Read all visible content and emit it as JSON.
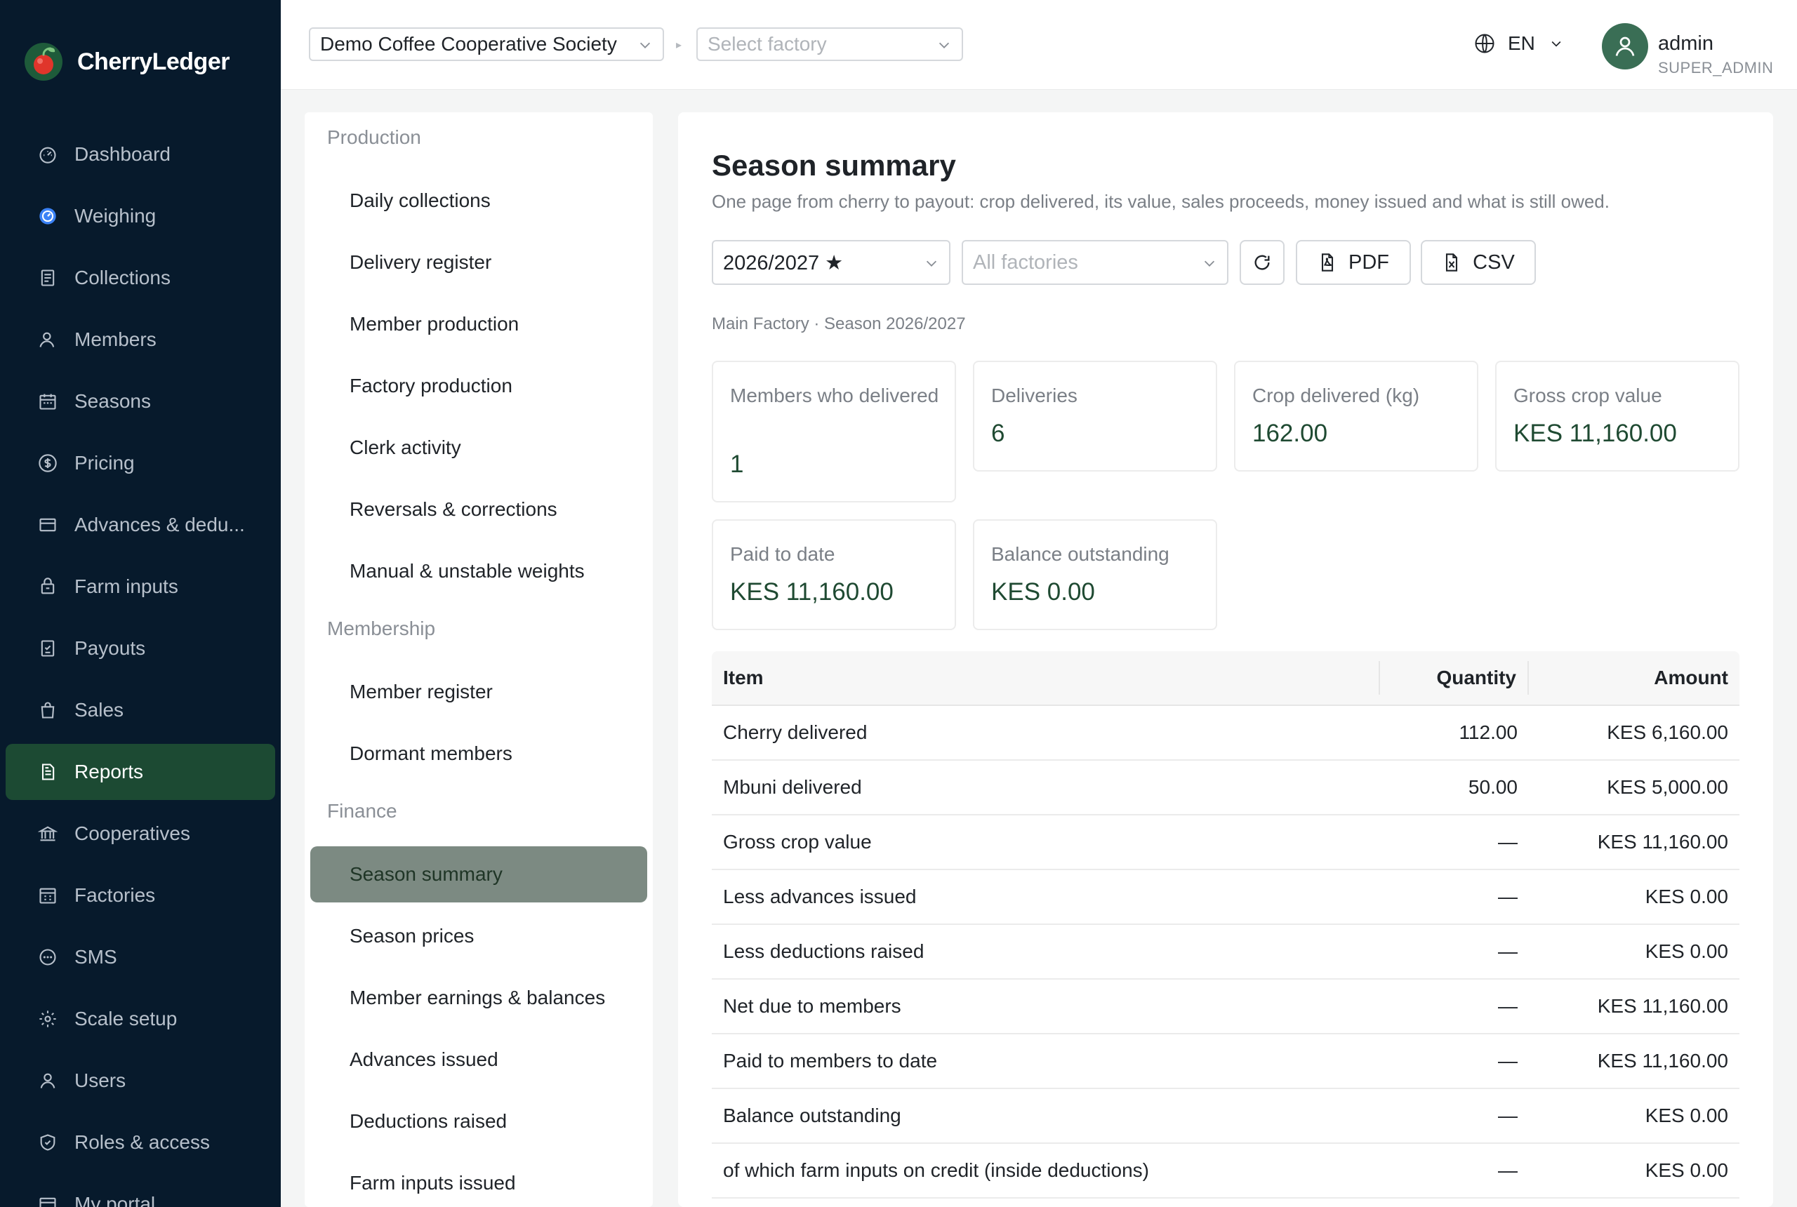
{
  "brand": {
    "name": "CherryLedger",
    "logo_icon": "cherry-logo-icon",
    "accent": "#1c4a33"
  },
  "sidebar": {
    "items": [
      {
        "label": "Dashboard",
        "icon": "dashboard-icon"
      },
      {
        "label": "Weighing",
        "icon": "weighing-icon"
      },
      {
        "label": "Collections",
        "icon": "collections-icon"
      },
      {
        "label": "Members",
        "icon": "members-icon"
      },
      {
        "label": "Seasons",
        "icon": "calendar-icon"
      },
      {
        "label": "Pricing",
        "icon": "dollar-icon"
      },
      {
        "label": "Advances & dedu...",
        "icon": "card-icon"
      },
      {
        "label": "Farm inputs",
        "icon": "bag-icon"
      },
      {
        "label": "Payouts",
        "icon": "payout-icon"
      },
      {
        "label": "Sales",
        "icon": "shopping-bag-icon"
      },
      {
        "label": "Reports",
        "icon": "report-icon",
        "active": true
      },
      {
        "label": "Cooperatives",
        "icon": "bank-icon"
      },
      {
        "label": "Factories",
        "icon": "factory-icon"
      },
      {
        "label": "SMS",
        "icon": "message-icon"
      },
      {
        "label": "Scale setup",
        "icon": "gear-icon"
      },
      {
        "label": "Users",
        "icon": "user-icon"
      },
      {
        "label": "Roles & access",
        "icon": "shield-icon"
      },
      {
        "label": "My portal",
        "icon": "portal-icon"
      }
    ]
  },
  "topbar": {
    "organization": "Demo Coffee Cooperative Society",
    "factory_placeholder": "Select factory",
    "language": "EN",
    "user": {
      "name": "admin",
      "role": "SUPER_ADMIN"
    }
  },
  "report_menu": {
    "groups": [
      {
        "title": "Production",
        "items": [
          "Daily collections",
          "Delivery register",
          "Member production",
          "Factory production",
          "Clerk activity",
          "Reversals & corrections",
          "Manual & unstable weights"
        ]
      },
      {
        "title": "Membership",
        "items": [
          "Member register",
          "Dormant members"
        ]
      },
      {
        "title": "Finance",
        "items": [
          "Season summary",
          "Season prices",
          "Member earnings & balances",
          "Advances issued",
          "Deductions raised",
          "Farm inputs issued"
        ]
      }
    ],
    "active": "Season summary"
  },
  "main": {
    "title": "Season summary",
    "subtitle": "One page from cherry to payout: crop delivered, its value, sales proceeds, money issued and what is still owed.",
    "season": "2026/2027 ★",
    "factory_filter_placeholder": "All factories",
    "buttons": {
      "pdf": "PDF",
      "csv": "CSV"
    },
    "scope": "Main Factory · Season 2026/2027",
    "cards": [
      {
        "label": "Members who delivered",
        "value": "1"
      },
      {
        "label": "Deliveries",
        "value": "6"
      },
      {
        "label": "Crop delivered (kg)",
        "value": "162.00"
      },
      {
        "label": "Gross crop value",
        "value": "KES 11,160.00"
      },
      {
        "label": "Paid to date",
        "value": "KES 11,160.00"
      },
      {
        "label": "Balance outstanding",
        "value": "KES 0.00"
      }
    ],
    "table": {
      "headers": {
        "item": "Item",
        "quantity": "Quantity",
        "amount": "Amount"
      },
      "rows": [
        {
          "item": "Cherry delivered",
          "quantity": "112.00",
          "amount": "KES 6,160.00"
        },
        {
          "item": "Mbuni delivered",
          "quantity": "50.00",
          "amount": "KES 5,000.00"
        },
        {
          "item": "Gross crop value",
          "quantity": "—",
          "amount": "KES 11,160.00"
        },
        {
          "item": "Less advances issued",
          "quantity": "—",
          "amount": "KES 0.00"
        },
        {
          "item": "Less deductions raised",
          "quantity": "—",
          "amount": "KES 0.00"
        },
        {
          "item": "Net due to members",
          "quantity": "—",
          "amount": "KES 11,160.00"
        },
        {
          "item": "Paid to members to date",
          "quantity": "—",
          "amount": "KES 11,160.00"
        },
        {
          "item": "Balance outstanding",
          "quantity": "—",
          "amount": "KES 0.00"
        },
        {
          "item": "of which farm inputs on credit (inside deductions)",
          "quantity": "—",
          "amount": "KES 0.00"
        }
      ]
    }
  }
}
